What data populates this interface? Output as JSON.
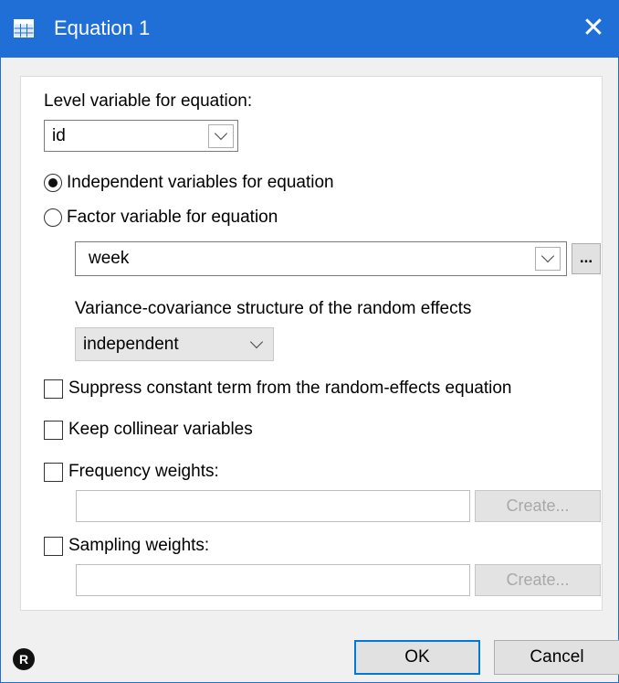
{
  "window": {
    "title": "Equation 1",
    "close_glyph": "✕"
  },
  "level": {
    "label": "Level variable for equation:",
    "value": "id"
  },
  "options": {
    "independent_label": "Independent variables for equation",
    "factor_label": "Factor variable for equation",
    "selected": "independent"
  },
  "factor": {
    "value": "week",
    "browse_label": "..."
  },
  "covariance": {
    "label": "Variance-covariance structure of the random effects",
    "value": "independent"
  },
  "checks": {
    "suppress_label": "Suppress constant term from the random-effects equation",
    "collinear_label": "Keep collinear variables",
    "freq_label": "Frequency weights:",
    "sampling_label": "Sampling weights:"
  },
  "weights": {
    "freq_value": "",
    "sampling_value": "",
    "create_label": "Create..."
  },
  "footer": {
    "r_badge": "R",
    "ok_label": "OK",
    "cancel_label": "Cancel"
  },
  "colors": {
    "titlebar": "#1f6fd6",
    "accent": "#0078d7"
  },
  "icons": {
    "title": "grid-window-icon",
    "close": "close-icon",
    "dropdown": "chevron-down-icon",
    "reset": "r-badge-icon"
  }
}
